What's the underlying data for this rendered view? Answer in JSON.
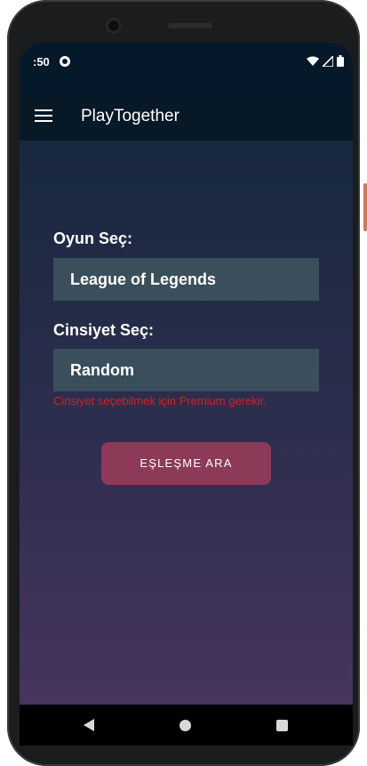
{
  "status_bar": {
    "time": ":50",
    "icons": [
      "app-notification-icon",
      "wifi-icon",
      "signal-icon",
      "battery-icon"
    ]
  },
  "toolbar": {
    "menu_icon": "hamburger-menu-icon",
    "title": "PlayTogether"
  },
  "form": {
    "game_label": "Oyun Seç:",
    "game_value": "League of Legends",
    "gender_label": "Cinsiyet Seç:",
    "gender_value": "Random",
    "error_text": "Cinsiyet seçebilmek için Premium gerekir.",
    "match_button_label": "EŞLEŞME ARA"
  },
  "nav_bar": {
    "icons": [
      "back-icon",
      "home-icon",
      "recents-icon"
    ]
  },
  "colors": {
    "status_bar": "#05192a",
    "toolbar": "#071827",
    "select_bg": "#3a4e5c",
    "button": "#8d3a59",
    "error": "#e01e1e"
  }
}
